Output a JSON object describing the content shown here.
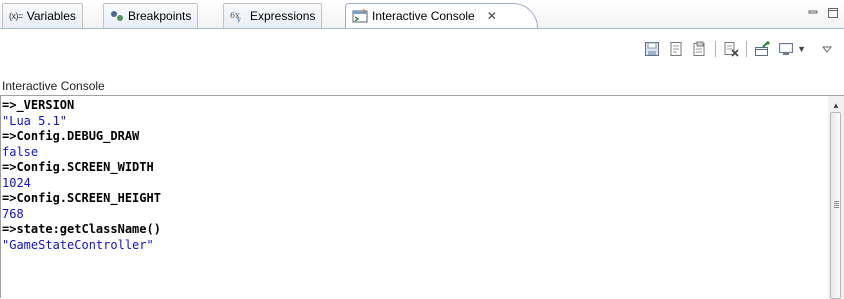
{
  "tabs": [
    {
      "label": "Variables",
      "icon": "variables-icon"
    },
    {
      "label": "Breakpoints",
      "icon": "breakpoints-icon"
    },
    {
      "label": "Expressions",
      "icon": "expressions-icon"
    },
    {
      "label": "Interactive Console",
      "icon": "interactive-console-icon",
      "active": true
    }
  ],
  "variables_icon_text": "(x)=",
  "tab_close_glyph": "✕",
  "console_title": "Interactive Console",
  "console_lines": [
    {
      "kind": "cmd",
      "text": "=>_VERSION"
    },
    {
      "kind": "out",
      "text": "\"Lua 5.1\""
    },
    {
      "kind": "cmd",
      "text": "=>Config.DEBUG_DRAW"
    },
    {
      "kind": "out",
      "text": "false"
    },
    {
      "kind": "cmd",
      "text": "=>Config.SCREEN_WIDTH"
    },
    {
      "kind": "out",
      "text": "1024"
    },
    {
      "kind": "cmd",
      "text": "=>Config.SCREEN_HEIGHT"
    },
    {
      "kind": "out",
      "text": "768"
    },
    {
      "kind": "cmd",
      "text": "=>state:getClassName()"
    },
    {
      "kind": "out",
      "text": "\"GameStateController\""
    }
  ],
  "colors": {
    "output_text": "#1111cc",
    "command_text": "#000000",
    "tab_border": "#9fb0c5"
  }
}
